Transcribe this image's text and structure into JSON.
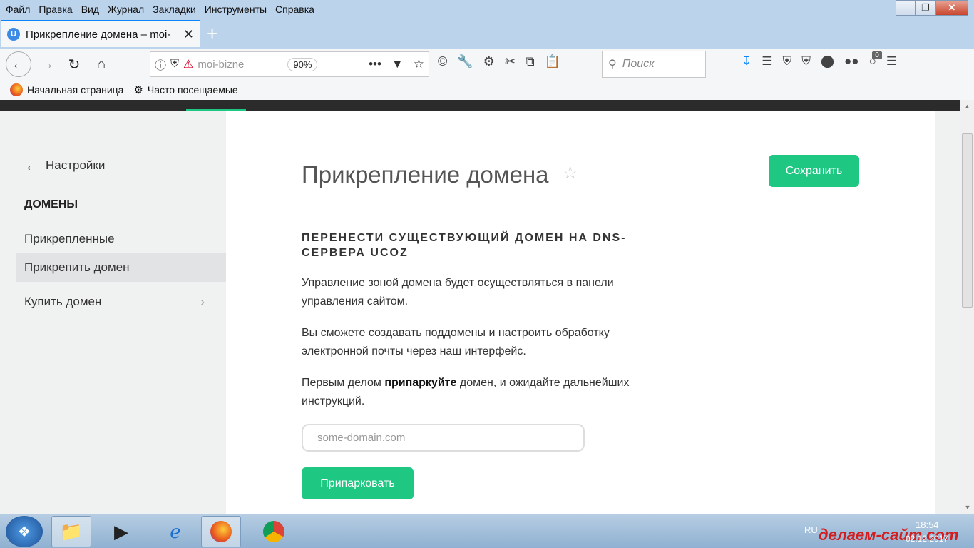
{
  "menubar": {
    "items": [
      "Файл",
      "Правка",
      "Вид",
      "Журнал",
      "Закладки",
      "Инструменты",
      "Справка"
    ]
  },
  "tab": {
    "favicon_letter": "U",
    "title": "Прикрепление домена – moi-"
  },
  "navbar": {
    "url": "moi-bizne",
    "zoom": "90%",
    "search_placeholder": "Поиск",
    "badge_count": "0"
  },
  "bookmarks": {
    "items": [
      "Начальная страница",
      "Часто посещаемые"
    ]
  },
  "sidebar": {
    "back_label": "Настройки",
    "heading": "ДОМЕНЫ",
    "items": [
      "Прикрепленные",
      "Прикрепить домен",
      "Купить домен"
    ]
  },
  "main": {
    "title": "Прикрепление домена",
    "save_label": "Сохранить",
    "section_title": "ПЕРЕНЕСТИ СУЩЕСТВУЮЩИЙ ДОМЕН НА DNS-СЕРВЕРА UCOZ",
    "para1": "Управление зоной домена будет осуществляться в панели управления сайтом.",
    "para2": "Вы сможете создавать поддомены и настроить обработку электронной почты через наш интерфейс.",
    "para3_before": "Первым делом ",
    "para3_bold": "припаркуйте",
    "para3_after": " домен, и ожидайте дальнейших инструкций.",
    "input_placeholder": "some-domain.com",
    "park_label": "Припарковать"
  },
  "taskbar": {
    "lang": "RU",
    "time": "18:54",
    "date": "02.12.2017",
    "watermark": "делаем-сайт.com"
  },
  "colors": {
    "accent": "#1ec883",
    "sidebar_bg": "#f0f1f1",
    "site_header": "#2b2b2b"
  }
}
